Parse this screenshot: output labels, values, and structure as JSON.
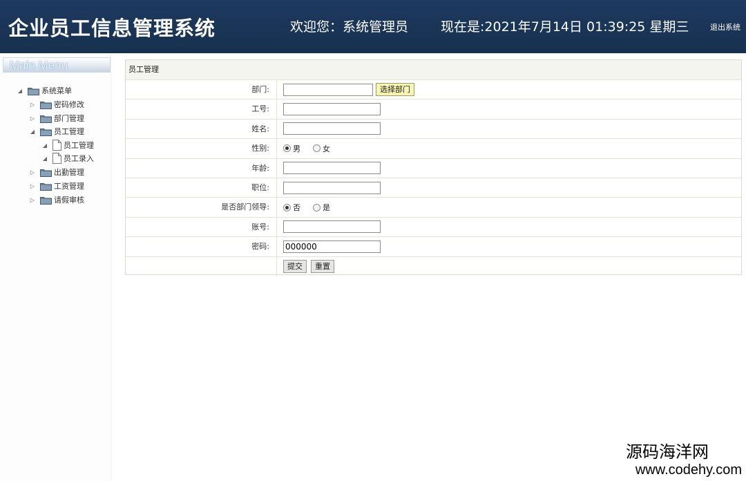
{
  "header": {
    "title": "企业员工信息管理系统",
    "welcome": "欢迎您：系统管理员",
    "datetime": "现在是:2021年7月14日 01:39:25 星期三",
    "logout": "退出系统"
  },
  "sidebar": {
    "menu_title": "Main Menu",
    "items": [
      {
        "label": "系统菜单",
        "expanded": true
      },
      {
        "label": "密码修改",
        "expanded": false
      },
      {
        "label": "部门管理",
        "expanded": false
      },
      {
        "label": "员工管理",
        "expanded": true
      },
      {
        "label": "员工管理",
        "type": "file"
      },
      {
        "label": "员工录入",
        "type": "file"
      },
      {
        "label": "出勤管理",
        "expanded": false
      },
      {
        "label": "工资管理",
        "expanded": false
      },
      {
        "label": "请假审核",
        "expanded": false
      }
    ]
  },
  "form": {
    "title": "员工管理",
    "dept_label": "部门:",
    "dept_value": "",
    "dept_pick_button": "选择部门",
    "empno_label": "工号:",
    "empno_value": "",
    "name_label": "姓名:",
    "name_value": "",
    "gender_label": "性别:",
    "gender_options": [
      "男",
      "女"
    ],
    "gender_selected": "男",
    "age_label": "年龄:",
    "age_value": "",
    "position_label": "职位:",
    "position_value": "",
    "leader_label": "是否部门领导:",
    "leader_options": [
      "否",
      "是"
    ],
    "leader_selected": "否",
    "account_label": "账号:",
    "account_value": "",
    "password_label": "密码:",
    "password_value": "000000",
    "submit_button": "提交",
    "reset_button": "重置"
  },
  "watermark": {
    "line1": "源码海洋网",
    "line2": "www.codehy.com"
  }
}
